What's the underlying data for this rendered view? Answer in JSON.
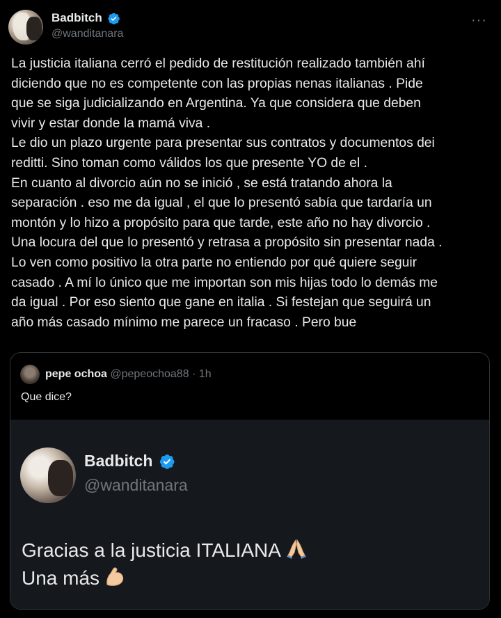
{
  "tweet": {
    "display_name": "Badbitch",
    "handle": "@wanditanara",
    "lines": [
      "La justicia italiana  cerró el pedido de restitución  realizado también ahí",
      "diciendo que no es competente con las propias nenas italianas . Pide",
      "que se siga judicializando en Argentina. Ya que considera que deben",
      "vivir y estar donde la mamá viva .",
      "Le dio un plazo urgente para presentar sus contratos y documentos dei",
      "reditti. Sino toman como válidos los que presente YO de el .",
      "En cuanto al divorcio aún no se inició , se está tratando ahora la",
      "separación . eso me da igual , el que lo presentó sabía que tardaría un",
      "montón y lo hizo a propósito para que tarde, este año no hay divorcio .",
      "Una locura del que lo presentó y retrasa a propósito sin presentar nada .",
      "Lo ven como positivo la otra parte  no entiendo por qué quiere seguir",
      "casado .  A mí lo único que me importan son mis hijas todo lo demás me",
      "da igual . Por eso siento que gane en italia . Si festejan que seguirá un",
      "año más casado mínimo me parece un fracaso . Pero bue"
    ]
  },
  "quote": {
    "display_name": "pepe ochoa",
    "meta": "@pepeochoa88 · 1h",
    "text": "Que dice?",
    "embedded": {
      "display_name": "Badbitch",
      "handle": "@wanditanara",
      "line1": "Gracias a la justicia ITALIANA",
      "line2": "Una más"
    }
  },
  "icons": {
    "verified": "verified-badge-icon",
    "more": "more-options-icon",
    "pray": "folded-hands-emoji",
    "flex": "flexed-biceps-emoji"
  },
  "colors": {
    "background": "#000000",
    "text": "#e7e9ea",
    "muted": "#71767b",
    "verified": "#1d9bf0",
    "inner_bg": "#15181c"
  }
}
